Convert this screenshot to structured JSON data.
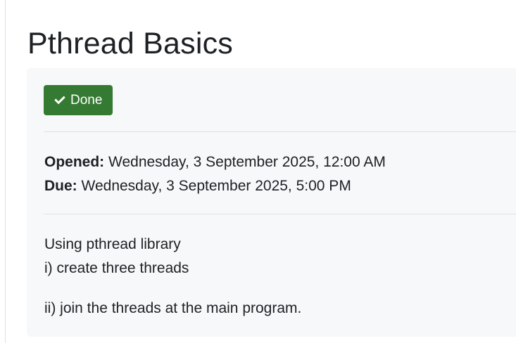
{
  "page": {
    "title": "Pthread Basics"
  },
  "completion": {
    "button_label": "Done",
    "icon": "check-icon",
    "color": "#357a32"
  },
  "dates": {
    "opened_label": "Opened:",
    "opened_value": "Wednesday, 3 September 2025, 12:00 AM",
    "due_label": "Due:",
    "due_value": "Wednesday, 3 September 2025, 5:00 PM"
  },
  "description": {
    "line1": "Using pthread library",
    "line2": "i) create three threads",
    "line3": "ii) join the threads at the main program."
  }
}
